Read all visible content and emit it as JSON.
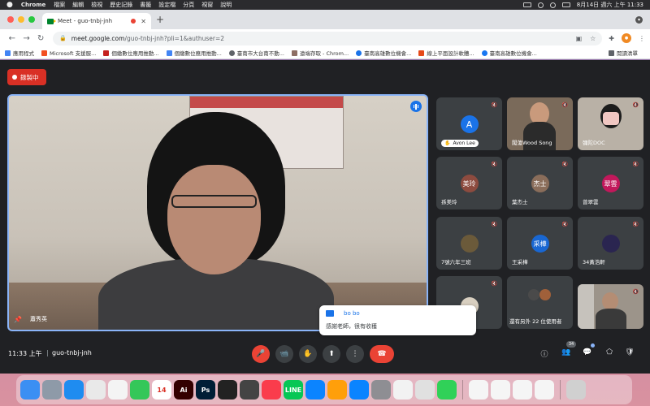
{
  "menubar": {
    "app": "Chrome",
    "items": [
      "檔案",
      "編輯",
      "檢視",
      "歷史記錄",
      "書籤",
      "設定檔",
      "分頁",
      "視窗",
      "說明"
    ],
    "clock": "8月14日 週六 上午 11:33"
  },
  "browser": {
    "tab_title": "Meet - guo-tnbj-jnh",
    "url_host": "meet.google.com",
    "url_path": "/guo-tnbj-jnh?pli=1&authuser=2",
    "bookmarks": [
      {
        "label": "應用程式",
        "color": "#4285f4"
      },
      {
        "label": "Microsoft 支援服...",
        "color": "#f25022"
      },
      {
        "label": "個繳數位應用推動...",
        "color": "#c5221f"
      },
      {
        "label": "個繳數位應用推動...",
        "color": "#4285f4"
      },
      {
        "label": "臺南市大台南不動...",
        "color": "#5f6368"
      },
      {
        "label": "遠端存取 - Chrom...",
        "color": "#8d6e63"
      },
      {
        "label": "臺南高雄數位機會...",
        "color": "#1a73e8"
      },
      {
        "label": "線上平面設計軟體...",
        "color": "#e64a19"
      },
      {
        "label": "臺南高雄數位機會...",
        "color": "#1877f2"
      }
    ],
    "reading_list": "閱讀清單"
  },
  "meet": {
    "recording_label": "錄製中",
    "main_speaker": "蕭秀英",
    "participants": [
      {
        "name": "Avon Lee",
        "initial": "A",
        "color": "#1a73e8",
        "type": "avatar",
        "hand": true
      },
      {
        "name": "闖蕩Wood Song",
        "initial": "",
        "color": "#7a6a5a",
        "type": "video"
      },
      {
        "name": "彌陀DOC",
        "initial": "",
        "color": "#b9b1a6",
        "type": "video"
      },
      {
        "name": "孫美玲",
        "initial": "美玲",
        "color": "#8d4b3f",
        "type": "avatar"
      },
      {
        "name": "葉杰士",
        "initial": "杰士",
        "color": "#8a6d5a",
        "type": "avatar"
      },
      {
        "name": "曾翠雲",
        "initial": "翠雲",
        "color": "#c2185b",
        "type": "avatar"
      },
      {
        "name": "7號六年三班",
        "initial": "",
        "color": "#6b5a3a",
        "type": "photo"
      },
      {
        "name": "王采樺",
        "initial": "采樺",
        "color": "#1967d2",
        "type": "avatar"
      },
      {
        "name": "34黃浩軒",
        "initial": "",
        "color": "#2a2550",
        "type": "photo"
      },
      {
        "name": "",
        "initial": "",
        "color": "#d8cfc0",
        "type": "photo"
      },
      {
        "name": "還有另外 22 位使用者",
        "initial": "",
        "color": "#5f6368",
        "type": "more"
      },
      {
        "name": "",
        "initial": "",
        "color": "#9c948a",
        "type": "video"
      }
    ],
    "chat": {
      "sender": "bo bo",
      "message": "感謝老師，很有收穫"
    },
    "time": "11:33 上午",
    "separator": "|",
    "meeting_code": "guo-tnbj-jnh",
    "participant_count": "34"
  },
  "icons": {
    "mic_off": "🎤",
    "camera": "📹",
    "hand": "✋",
    "present": "⬆",
    "more": "⋮",
    "end_call": "☎",
    "info": "ⓘ",
    "people": "👥",
    "chat": "💬",
    "activities": "⬠",
    "safety": "🛡"
  },
  "dock": [
    {
      "name": "finder",
      "color": "#3b8ff3",
      "glyph": ""
    },
    {
      "name": "launchpad",
      "color": "#8e9aa8",
      "glyph": ""
    },
    {
      "name": "safari",
      "color": "#1f8cf0",
      "glyph": ""
    },
    {
      "name": "chrome",
      "color": "#e9e9e9",
      "glyph": ""
    },
    {
      "name": "photos",
      "color": "#f4f4f4",
      "glyph": ""
    },
    {
      "name": "facetime",
      "color": "#34c759",
      "glyph": ""
    },
    {
      "name": "calendar",
      "color": "#ffffff",
      "glyph": "14"
    },
    {
      "name": "illustrator",
      "color": "#330000",
      "glyph": "Ai"
    },
    {
      "name": "photoshop",
      "color": "#001e36",
      "glyph": "Ps"
    },
    {
      "name": "final-cut",
      "color": "#222222",
      "glyph": ""
    },
    {
      "name": "quicktime",
      "color": "#444444",
      "glyph": ""
    },
    {
      "name": "music",
      "color": "#fa3c4c",
      "glyph": ""
    },
    {
      "name": "line",
      "color": "#06c755",
      "glyph": "LINE"
    },
    {
      "name": "keynote",
      "color": "#0b84ff",
      "glyph": ""
    },
    {
      "name": "pages",
      "color": "#ff9f0a",
      "glyph": ""
    },
    {
      "name": "app-store",
      "color": "#0a84ff",
      "glyph": ""
    },
    {
      "name": "system-preferences",
      "color": "#8e8e93",
      "glyph": ""
    },
    {
      "name": "textedit",
      "color": "#f2f2f2",
      "glyph": ""
    },
    {
      "name": "preview",
      "color": "#e0e0e0",
      "glyph": ""
    },
    {
      "name": "numbers",
      "color": "#30d158",
      "glyph": ""
    },
    {
      "name": "document-1",
      "color": "#f5f5f5",
      "glyph": ""
    },
    {
      "name": "document-2",
      "color": "#f5f5f5",
      "glyph": ""
    },
    {
      "name": "document-3",
      "color": "#f5f5f5",
      "glyph": ""
    },
    {
      "name": "document-4",
      "color": "#f5f5f5",
      "glyph": ""
    },
    {
      "name": "trash",
      "color": "#d0d0d0",
      "glyph": ""
    }
  ]
}
